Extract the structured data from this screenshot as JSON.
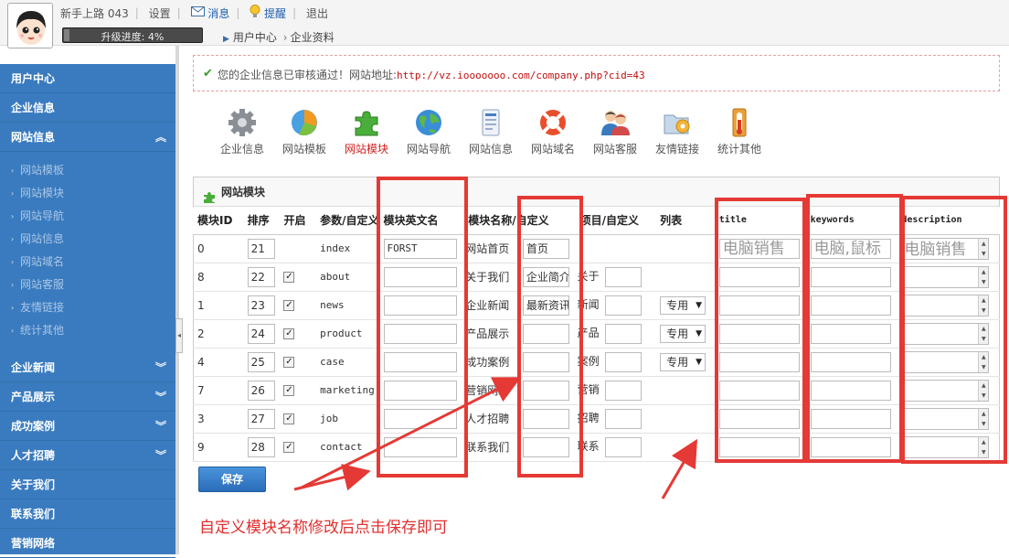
{
  "header": {
    "username": "新手上路 043",
    "settings": "设置",
    "messages": "消息",
    "reminders": "提醒",
    "logout": "退出",
    "progress_label": "升级进度: 4%",
    "progress_value": 0.04
  },
  "breadcrumb": {
    "home": "用户中心",
    "current": "企业资料"
  },
  "sidebar": {
    "user_center": "用户中心",
    "company_info": "企业信息",
    "site_info": "网站信息",
    "site_sub": [
      "网站模板",
      "网站模块",
      "网站导航",
      "网站信息",
      "网站域名",
      "网站客服",
      "友情链接",
      "统计其他"
    ],
    "groups": [
      "企业新闻",
      "产品展示",
      "成功案例",
      "人才招聘"
    ],
    "singles": [
      "关于我们",
      "联系我们",
      "营销网络"
    ]
  },
  "notice": {
    "text": "您的企业信息已审核通过！网站地址:",
    "url": "http://vz.iooooooo.com/company.php?cid=43"
  },
  "iconnav": [
    "企业信息",
    "网站模板",
    "网站模块",
    "网站导航",
    "网站信息",
    "网站域名",
    "网站客服",
    "友情链接",
    "统计其他"
  ],
  "panel_title": "网站模块",
  "columns": [
    "模块ID",
    "排序",
    "开启",
    "参数/自定义",
    "模块英文名",
    "模块名称/自定义",
    "项目/自定义",
    "列表",
    "title",
    "keywords",
    "description"
  ],
  "rows": [
    {
      "id": "0",
      "order": "21",
      "param": "index",
      "en": "FORST",
      "name": "网站首页",
      "custom": "首页",
      "item": "",
      "item_custom": "",
      "list": "",
      "title": "电脑销售",
      "keywords": "电脑,鼠标",
      "description": "电脑销售公司"
    },
    {
      "id": "8",
      "order": "22",
      "param": "about",
      "en": "",
      "name": "关于我们",
      "custom": "企业简介",
      "item": "关于",
      "item_custom": "",
      "list": "",
      "title": "",
      "keywords": "",
      "description": ""
    },
    {
      "id": "1",
      "order": "23",
      "param": "news",
      "en": "",
      "name": "企业新闻",
      "custom": "最新资讯",
      "item": "新闻",
      "item_custom": "",
      "list": "专用",
      "title": "",
      "keywords": "",
      "description": ""
    },
    {
      "id": "2",
      "order": "24",
      "param": "product",
      "en": "",
      "name": "产品展示",
      "custom": "",
      "item": "产品",
      "item_custom": "",
      "list": "专用",
      "title": "",
      "keywords": "",
      "description": ""
    },
    {
      "id": "4",
      "order": "25",
      "param": "case",
      "en": "",
      "name": "成功案例",
      "custom": "",
      "item": "案例",
      "item_custom": "",
      "list": "专用",
      "title": "",
      "keywords": "",
      "description": ""
    },
    {
      "id": "7",
      "order": "26",
      "param": "marketing",
      "en": "",
      "name": "营销网络",
      "custom": "",
      "item": "营销",
      "item_custom": "",
      "list": "",
      "title": "",
      "keywords": "",
      "description": ""
    },
    {
      "id": "3",
      "order": "27",
      "param": "job",
      "en": "",
      "name": "人才招聘",
      "custom": "",
      "item": "招聘",
      "item_custom": "",
      "list": "",
      "title": "",
      "keywords": "",
      "description": ""
    },
    {
      "id": "9",
      "order": "28",
      "param": "contact",
      "en": "",
      "name": "联系我们",
      "custom": "",
      "item": "联系",
      "item_custom": "",
      "list": "",
      "title": "",
      "keywords": "",
      "description": ""
    }
  ],
  "save_label": "保存",
  "annotation_text": "自定义模块名称修改后点击保存即可",
  "colors": {
    "sidebar": "#3a7bbf",
    "annotation": "#e53935",
    "active_nav": "#d02020"
  }
}
